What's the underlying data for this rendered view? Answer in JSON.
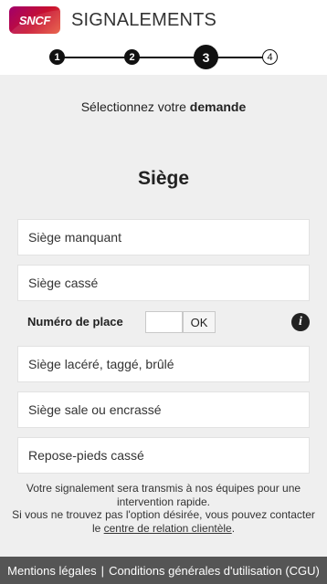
{
  "header": {
    "logo_text": "SNCF",
    "title": "SIGNALEMENTS"
  },
  "stepper": {
    "current_step": 3,
    "steps": [
      "1",
      "2",
      "3",
      "4"
    ]
  },
  "prompt": {
    "prefix": "Sélectionnez votre ",
    "emphasis": "demande"
  },
  "section": {
    "title": "Siège"
  },
  "options": [
    "Siège manquant",
    "Siège cassé",
    "Siège lacéré, taggé, brûlé",
    "Siège sale ou encrassé",
    "Repose-pieds cassé"
  ],
  "seat_number": {
    "label": "Numéro de place",
    "value": "",
    "ok_label": "OK",
    "info_icon": "i"
  },
  "note": {
    "line1": "Votre signalement sera transmis à nos équipes pour une intervention rapide.",
    "line2_prefix": "Si vous ne trouvez pas l'option désirée, vous pouvez contacter le ",
    "link": "centre de relation clientèle",
    "line2_suffix": "."
  },
  "footer": {
    "legal": "Mentions légales",
    "separator": "|",
    "cgu": "Conditions générales d'utilisation (CGU)"
  },
  "colors": {
    "background": "#efefef",
    "footer": "#555555",
    "stepper": "#111111"
  }
}
